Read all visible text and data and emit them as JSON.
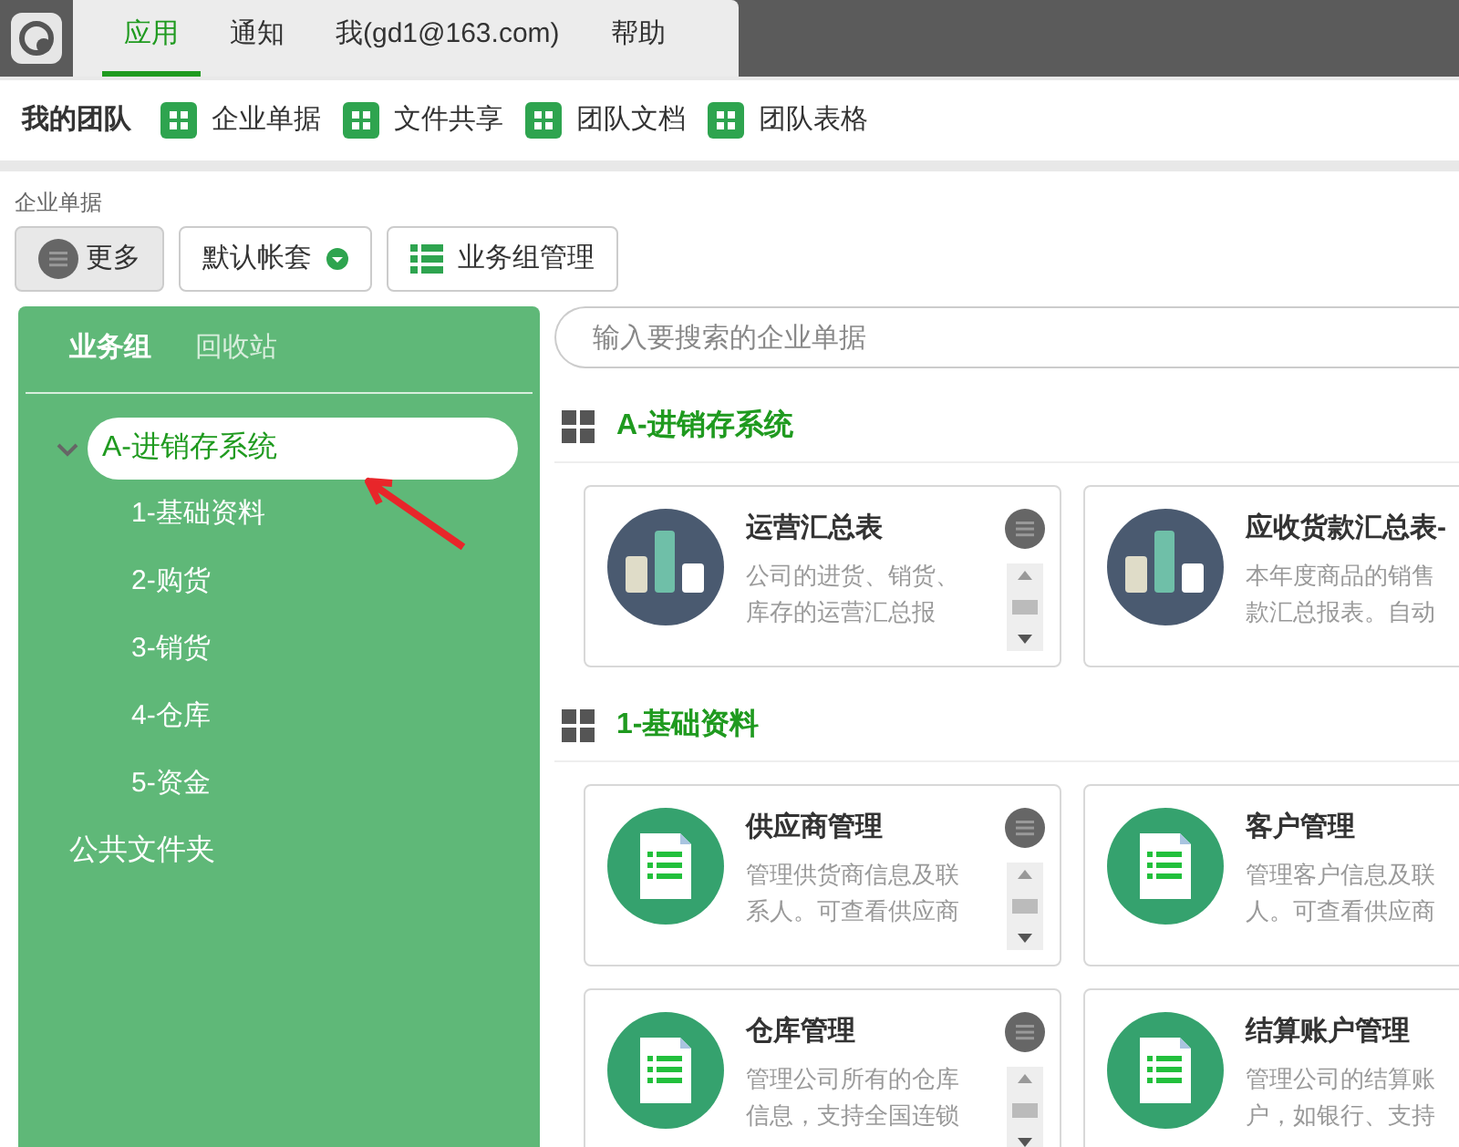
{
  "top_tabs": [
    {
      "label": "应用",
      "selected": true
    },
    {
      "label": "通知",
      "selected": false
    },
    {
      "label": "我(gd1@163.com)",
      "selected": false
    },
    {
      "label": "帮助",
      "selected": false
    }
  ],
  "team_bar": {
    "title": "我的团队",
    "links": [
      "企业单据",
      "文件共享",
      "团队文档",
      "团队表格"
    ]
  },
  "breadcrumb": "企业单据",
  "toolbar": {
    "more": "更多",
    "account": "默认帐套",
    "manage": "业务组管理"
  },
  "sidebar": {
    "tabs": [
      {
        "label": "业务组",
        "selected": true
      },
      {
        "label": "回收站",
        "selected": false
      }
    ],
    "tree": [
      {
        "label": "A-进销存系统",
        "selected": true,
        "expanded": true,
        "children": [
          {
            "label": "1-基础资料",
            "selected": false
          },
          {
            "label": "2-购货",
            "selected": false
          },
          {
            "label": "3-销货",
            "selected": false
          },
          {
            "label": "4-仓库",
            "selected": false
          },
          {
            "label": "5-资金",
            "selected": false
          }
        ]
      },
      {
        "label": "公共文件夹",
        "selected": false
      }
    ]
  },
  "search": {
    "placeholder": "输入要搜索的企业单据"
  },
  "sections": [
    {
      "title": "A-进销存系统",
      "cards": [
        {
          "kind": "report",
          "title": "运营汇总表",
          "desc_lines": [
            "公司的进货、销货、",
            "库存的运营汇总报"
          ]
        },
        {
          "kind": "report",
          "title": "应收货款汇总表-",
          "desc_lines": [
            "本年度商品的销售",
            "款汇总报表。自动"
          ]
        }
      ]
    },
    {
      "title": "1-基础资料",
      "cards": [
        {
          "kind": "form",
          "title": "供应商管理",
          "desc_lines": [
            "管理供货商信息及联",
            "系人。可查看供应商"
          ]
        },
        {
          "kind": "form",
          "title": "客户管理",
          "desc_lines": [
            "管理客户信息及联",
            "人。可查看供应商"
          ]
        },
        {
          "kind": "form",
          "title": "仓库管理",
          "desc_lines": [
            "管理公司所有的仓库",
            "信息，支持全国连锁"
          ]
        },
        {
          "kind": "form",
          "title": "结算账户管理",
          "desc_lines": [
            "管理公司的结算账",
            "户，如银行、支持"
          ]
        }
      ]
    }
  ]
}
